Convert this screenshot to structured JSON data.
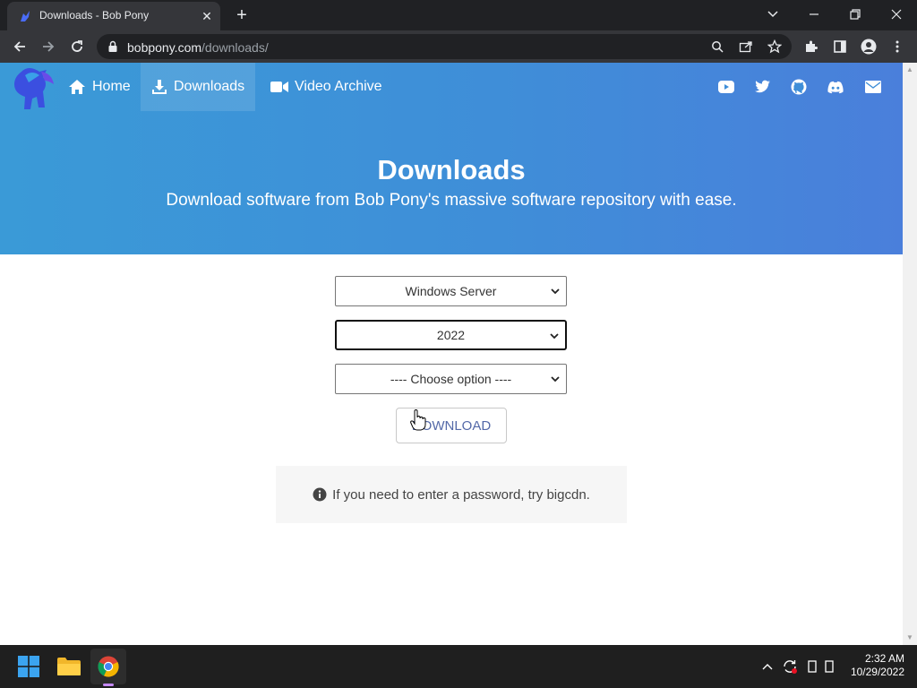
{
  "browser": {
    "tab_title": "Downloads - Bob Pony",
    "url_host": "bobpony.com",
    "url_path": "/downloads/"
  },
  "site": {
    "nav": [
      {
        "label": "Home",
        "icon": "home-icon"
      },
      {
        "label": "Downloads",
        "icon": "download-icon"
      },
      {
        "label": "Video Archive",
        "icon": "video-camera-icon"
      }
    ],
    "social_icons": [
      "youtube-icon",
      "twitter-icon",
      "github-icon",
      "discord-icon",
      "mail-icon"
    ],
    "hero_title": "Downloads",
    "hero_subtitle": "Download software from Bob Pony's massive software repository with ease.",
    "colors": {
      "hero_start": "#3a9ad7",
      "hero_end": "#4a7fdb",
      "button_text": "#5469a8"
    }
  },
  "form": {
    "product_select": "Windows Server",
    "version_select": "2022",
    "option_select": "---- Choose option ----",
    "download_label": "DOWNLOAD",
    "notice_text": "If you need to enter a password, try bigcdn."
  },
  "taskbar": {
    "time": "2:32 AM",
    "date": "10/29/2022"
  }
}
